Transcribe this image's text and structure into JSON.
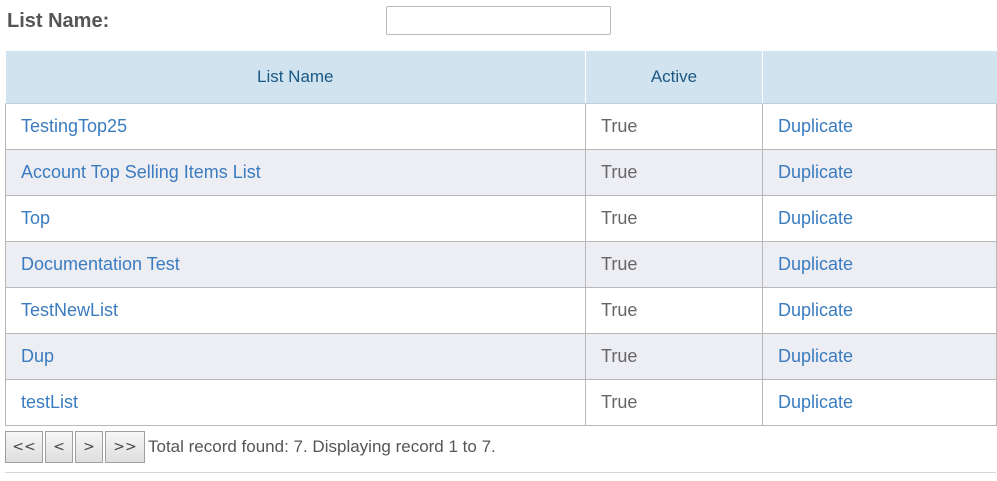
{
  "filter": {
    "label": "List Name:",
    "value": "",
    "placeholder": ""
  },
  "table": {
    "columns": [
      "List Name",
      "Active",
      ""
    ],
    "rows": [
      {
        "name": "TestingTop25",
        "active": "True",
        "action": "Duplicate"
      },
      {
        "name": "Account Top Selling Items List",
        "active": "True",
        "action": "Duplicate"
      },
      {
        "name": "Top",
        "active": "True",
        "action": "Duplicate"
      },
      {
        "name": "Documentation Test",
        "active": "True",
        "action": "Duplicate"
      },
      {
        "name": "TestNewList",
        "active": "True",
        "action": "Duplicate"
      },
      {
        "name": "Dup",
        "active": "True",
        "action": "Duplicate"
      },
      {
        "name": "testList",
        "active": "True",
        "action": "Duplicate"
      }
    ]
  },
  "pager": {
    "first": "<<",
    "prev": "<",
    "next": ">",
    "last": ">>",
    "status": "Total record found: 7. Displaying record 1 to 7."
  },
  "colors": {
    "header_bg": "#d0e3ef",
    "header_text": "#1b5884",
    "link": "#3a7cbf",
    "alt_row": "#ededf4"
  }
}
